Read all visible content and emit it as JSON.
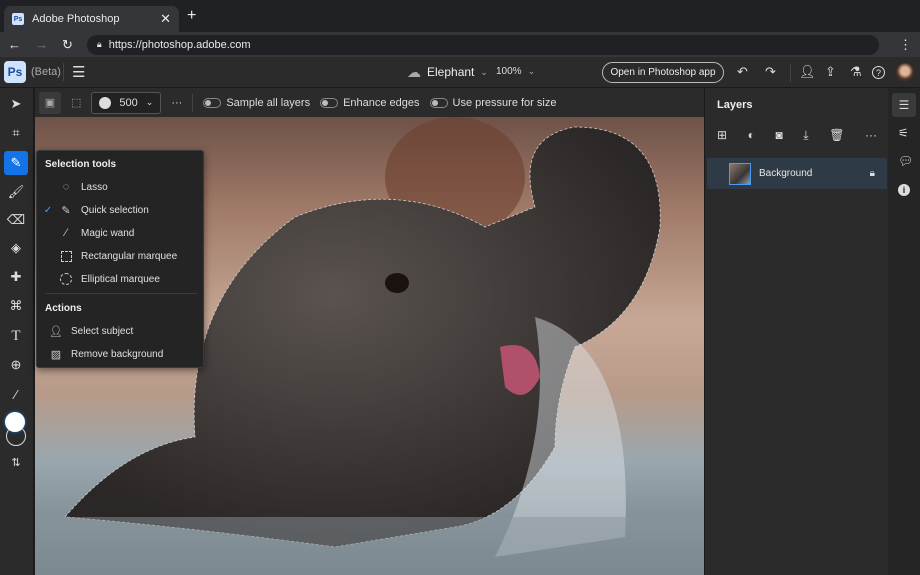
{
  "browser": {
    "tab_title": "Adobe Photoshop",
    "url": "https://photoshop.adobe.com",
    "favicon": "Ps"
  },
  "app": {
    "logo": "Ps",
    "beta": "(Beta)",
    "doc_name": "Elephant",
    "zoom": "100%",
    "open_app": "Open in Photoshop app",
    "accent": "#1473e6"
  },
  "options": {
    "brush_size": "500",
    "sample_all": "Sample all layers",
    "enhance": "Enhance edges",
    "pressure": "Use pressure for size"
  },
  "menu": {
    "header1": "Selection tools",
    "items": [
      {
        "label": "Lasso",
        "icon": "lasso-icon"
      },
      {
        "label": "Quick selection",
        "icon": "quick-selection-icon",
        "checked": true
      },
      {
        "label": "Magic wand",
        "icon": "magic-wand-icon"
      },
      {
        "label": "Rectangular marquee",
        "icon": "rect-marquee-icon"
      },
      {
        "label": "Elliptical marquee",
        "icon": "ellipse-marquee-icon"
      }
    ],
    "header2": "Actions",
    "actions": [
      {
        "label": "Select subject"
      },
      {
        "label": "Remove background"
      }
    ]
  },
  "layers": {
    "title": "Layers",
    "items": [
      {
        "name": "Background",
        "locked": true
      }
    ]
  }
}
